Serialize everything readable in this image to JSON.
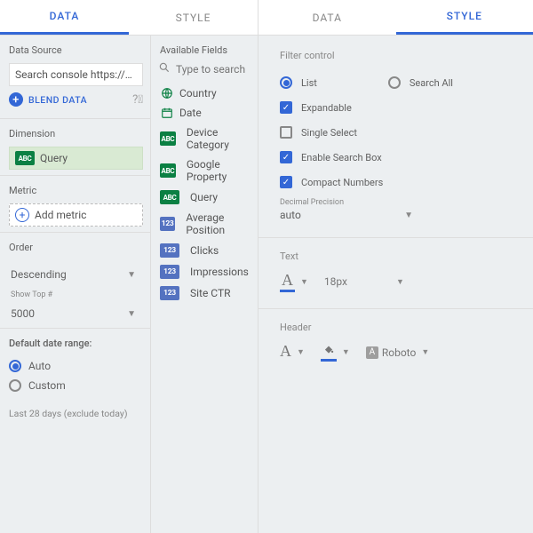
{
  "leftTabs": {
    "data": "DATA",
    "style": "STYLE"
  },
  "rightTabs": {
    "data": "DATA",
    "style": "STYLE"
  },
  "dataSource": {
    "title": "Data Source",
    "value": "Search console https://…",
    "blend": "BLEND DATA"
  },
  "dimension": {
    "title": "Dimension",
    "value": "Query"
  },
  "metric": {
    "title": "Metric",
    "add": "Add metric"
  },
  "order": {
    "title": "Order",
    "value": "Descending",
    "topLabel": "Show Top #",
    "topValue": "5000"
  },
  "dateRange": {
    "title": "Default date range:",
    "auto": "Auto",
    "custom": "Custom",
    "note": "Last 28 days (exclude today)"
  },
  "fields": {
    "title": "Available Fields",
    "placeholder": "Type to search",
    "items": [
      {
        "label": "Country",
        "type": "globe"
      },
      {
        "label": "Date",
        "type": "date"
      },
      {
        "label": "Device Category",
        "type": "abc"
      },
      {
        "label": "Google Property",
        "type": "abc"
      },
      {
        "label": "Query",
        "type": "abc"
      },
      {
        "label": "Average Position",
        "type": "num"
      },
      {
        "label": "Clicks",
        "type": "num"
      },
      {
        "label": "Impressions",
        "type": "num"
      },
      {
        "label": "Site CTR",
        "type": "num"
      }
    ]
  },
  "style": {
    "filterTitle": "Filter control",
    "list": "List",
    "searchAll": "Search All",
    "expandable": "Expandable",
    "singleSelect": "Single Select",
    "enableSearch": "Enable Search Box",
    "compact": "Compact Numbers",
    "precisionLabel": "Decimal Precision",
    "precisionValue": "auto",
    "textTitle": "Text",
    "fontSize": "18px",
    "headerTitle": "Header",
    "fontName": "Roboto"
  }
}
